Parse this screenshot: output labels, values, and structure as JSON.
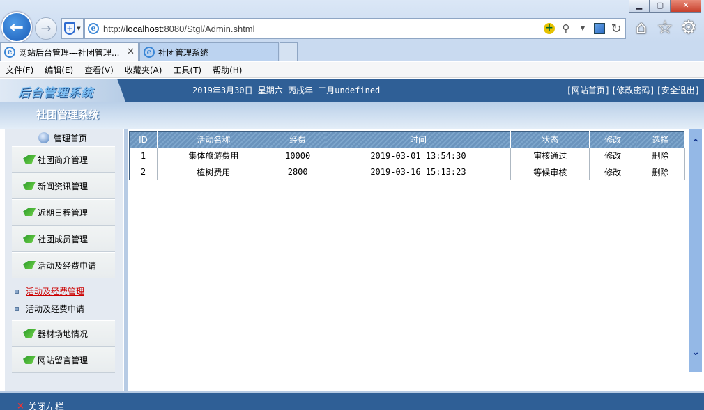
{
  "browser": {
    "url_prefix": "http://",
    "url_host": "localhost",
    "url_rest": ":8080/Stgl/Admin.shtml",
    "tabs": [
      {
        "label": "网站后台管理---社团管理..."
      },
      {
        "label": "社团管理系统"
      }
    ],
    "menu": [
      "文件(F)",
      "编辑(E)",
      "查看(V)",
      "收藏夹(A)",
      "工具(T)",
      "帮助(H)"
    ],
    "icons": {
      "back": "back-arrow-icon",
      "forward": "forward-arrow-icon",
      "home": "home-icon",
      "favorites": "star-icon",
      "tools": "gear-icon"
    }
  },
  "header": {
    "logo": "后台管理系统",
    "date": "2019年3月30日 星期六 丙戌年 二月undefined",
    "links": [
      "[网站首页]",
      "[修改密码]",
      "[安全退出]"
    ],
    "system_title": "社团管理系统"
  },
  "sidebar": {
    "home_label": "管理首页",
    "items_top": [
      {
        "label": "社团简介管理"
      },
      {
        "label": "新闻资讯管理"
      },
      {
        "label": "近期日程管理"
      },
      {
        "label": "社团成员管理"
      },
      {
        "label": "活动及经费申请"
      }
    ],
    "sub_items": [
      {
        "label": "活动及经费管理",
        "active": true
      },
      {
        "label": "活动及经费申请",
        "active": false
      }
    ],
    "items_bottom": [
      {
        "label": "器材场地情况"
      },
      {
        "label": "网站留言管理"
      }
    ]
  },
  "table": {
    "headers": [
      "ID",
      "活动名称",
      "经费",
      "时间",
      "状态",
      "修改",
      "选择"
    ],
    "rows": [
      [
        "1",
        "集体旅游费用",
        "10000",
        "2019-03-01 13:54:30",
        "审核通过",
        "修改",
        "删除"
      ],
      [
        "2",
        "植树费用",
        "2800",
        "2019-03-16 15:13:23",
        "等候审核",
        "修改",
        "删除"
      ]
    ]
  },
  "footer": {
    "close_left": "关闭左栏"
  },
  "colors": {
    "header_band": "#2f5f96",
    "table_header": "#7ea6cc",
    "active_link": "#cc0000"
  }
}
